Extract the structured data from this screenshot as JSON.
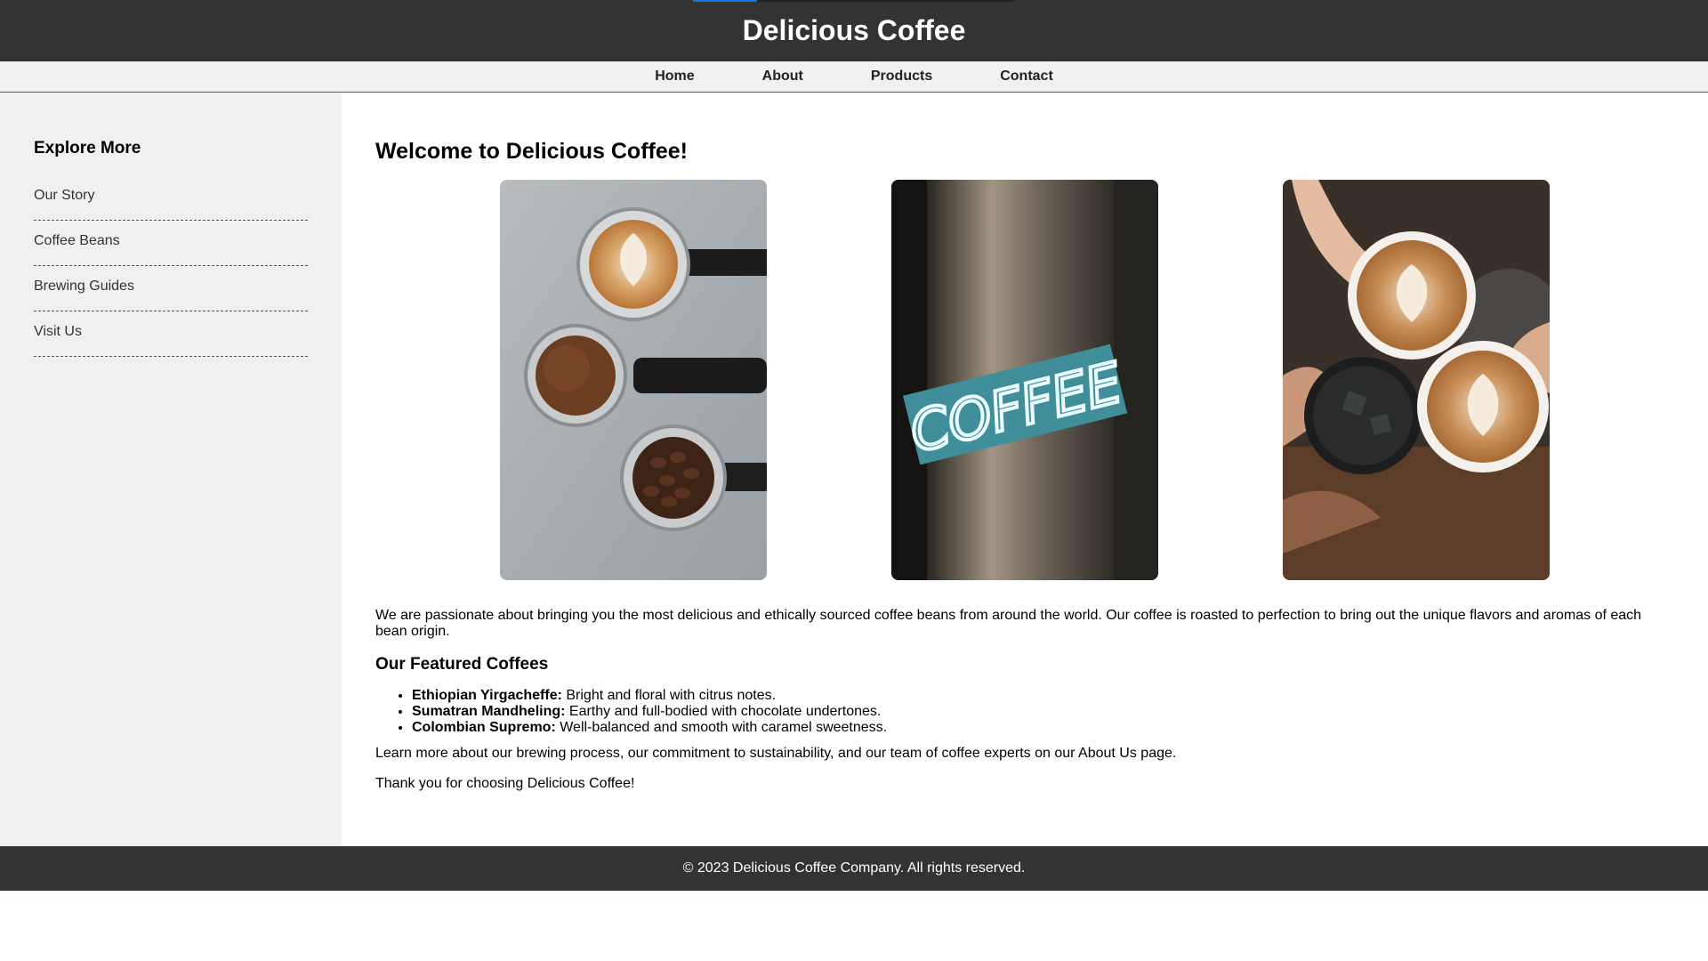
{
  "header": {
    "title": "Delicious Coffee"
  },
  "nav": {
    "items": [
      "Home",
      "About",
      "Products",
      "Contact"
    ]
  },
  "sidebar": {
    "heading": "Explore More",
    "items": [
      "Our Story",
      "Coffee Beans",
      "Brewing Guides",
      "Visit Us"
    ]
  },
  "main": {
    "heading": "Welcome to Delicious Coffee!",
    "intro": "We are passionate about bringing you the most delicious and ethically sourced coffee beans from around the world. Our coffee is roasted to perfection to bring out the unique flavors and aromas of each bean origin.",
    "featured_heading": "Our Featured Coffees",
    "featured": [
      {
        "name": "Ethiopian Yirgacheffe:",
        "desc": " Bright and floral with citrus notes."
      },
      {
        "name": "Sumatran Mandheling:",
        "desc": " Earthy and full-bodied with chocolate undertones."
      },
      {
        "name": "Colombian Supremo:",
        "desc": " Well-balanced and smooth with caramel sweetness."
      }
    ],
    "learn_more": "Learn more about our brewing process, our commitment to sustainability, and our team of coffee experts on our About Us page.",
    "thanks": "Thank you for choosing Delicious Coffee!",
    "neon_sign_text": "COFFEE"
  },
  "footer": {
    "text": "© 2023 Delicious Coffee Company. All rights reserved."
  },
  "colors": {
    "header_bg": "#333333",
    "nav_bg": "#f1f1f1",
    "sidebar_bg": "#f0f0f0",
    "accent": "#1a73e8"
  }
}
